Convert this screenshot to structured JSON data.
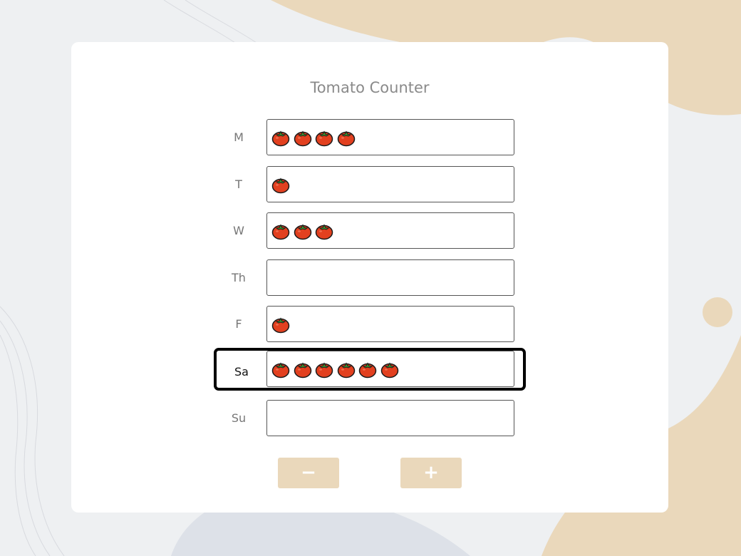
{
  "app": {
    "title": "Tomato Counter",
    "tomato_icon": "tomato-icon"
  },
  "days": [
    {
      "label": "M",
      "count": 4
    },
    {
      "label": "T",
      "count": 1
    },
    {
      "label": "W",
      "count": 3
    },
    {
      "label": "Th",
      "count": 0
    },
    {
      "label": "F",
      "count": 1
    },
    {
      "label": "Sa",
      "count": 6,
      "selected": true
    },
    {
      "label": "Su",
      "count": 0
    }
  ],
  "controls": {
    "decrement_label": "−",
    "increment_label": "+"
  },
  "colors": {
    "button_bg": "#ead8bb",
    "tomato_red": "#e2401f",
    "tomato_green": "#3f9b2f",
    "accent_beige": "#ead8bb"
  }
}
